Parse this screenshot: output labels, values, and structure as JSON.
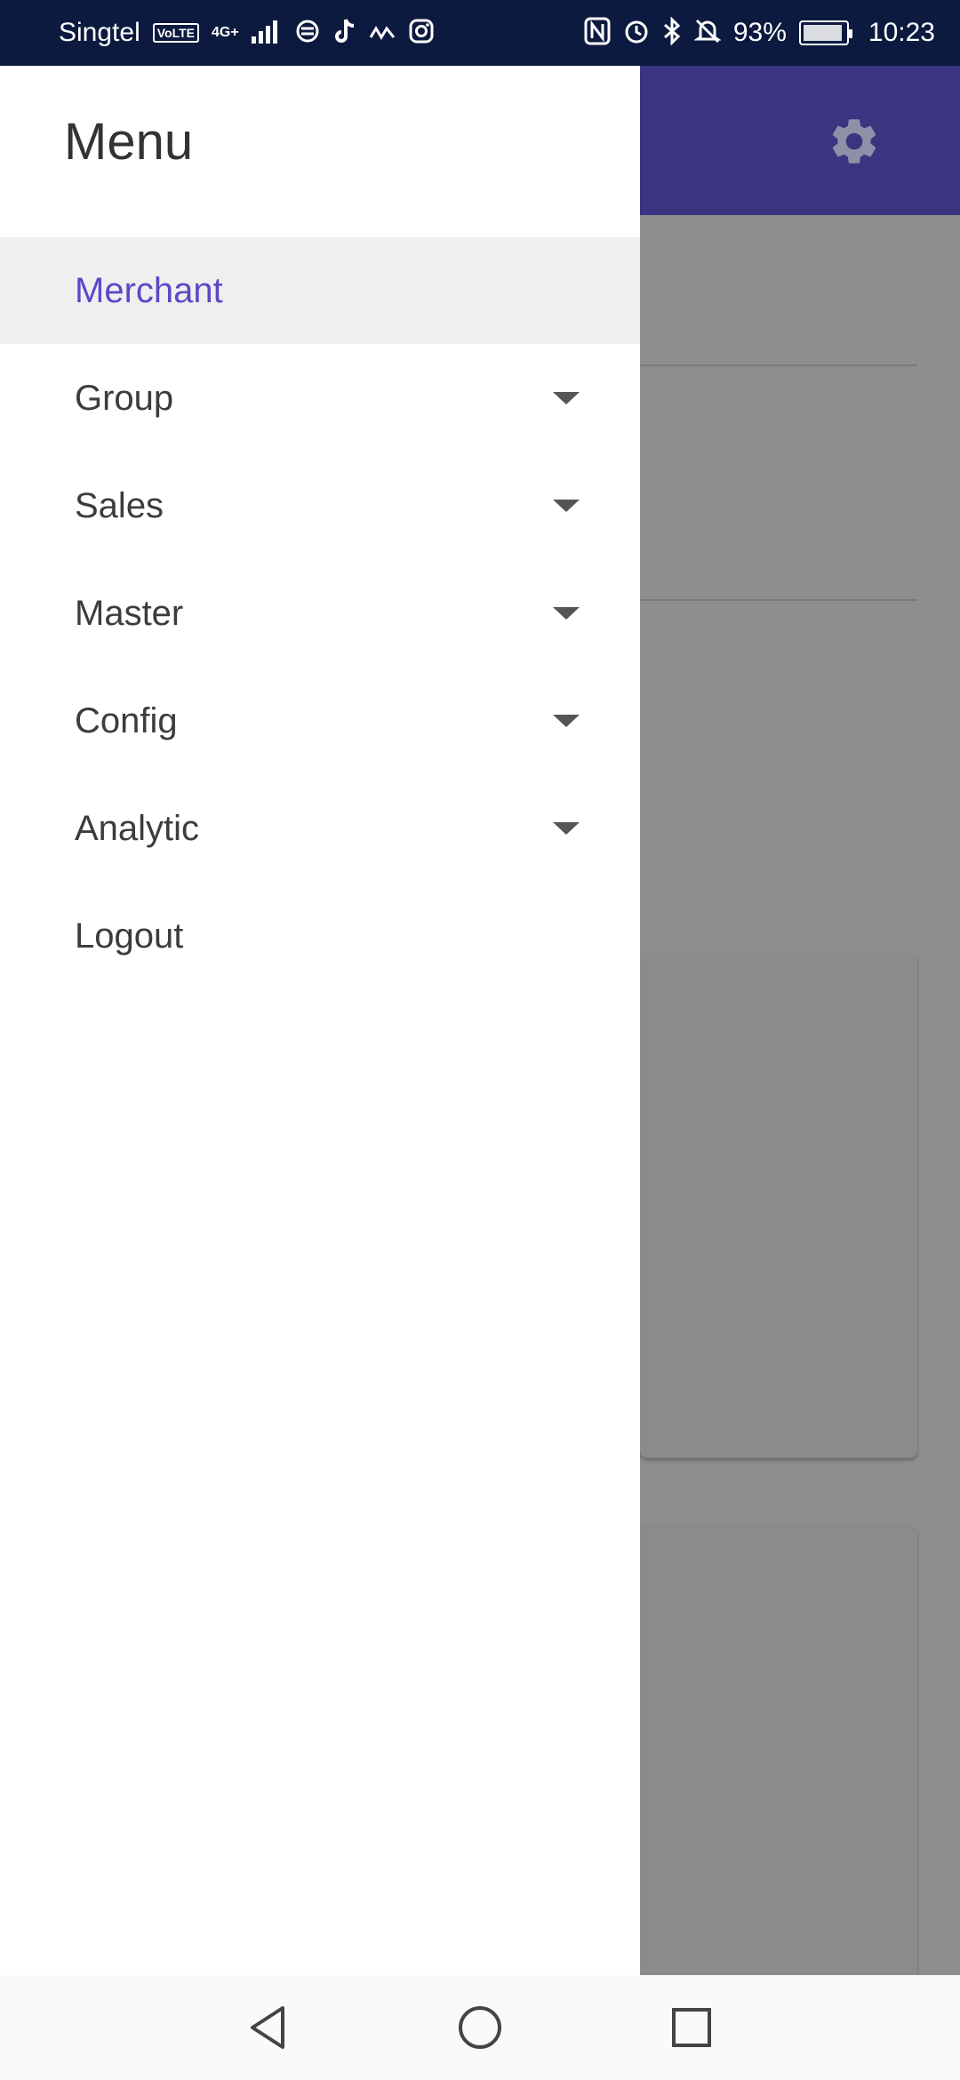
{
  "status_bar": {
    "carrier": "Singtel",
    "volte": "VoLTE",
    "network": "4G+",
    "battery_percent": "93%",
    "battery_level": 0.93,
    "time": "10:23",
    "icons": [
      "signal-icon",
      "app-notification-icon",
      "tiktok-icon",
      "wave-icon",
      "instagram-icon",
      "nfc-icon",
      "alarm-icon",
      "bluetooth-icon",
      "mute-icon",
      "battery-icon"
    ]
  },
  "app_bar": {
    "color": "#3b3480",
    "settings_icon": "gear-icon"
  },
  "drawer": {
    "title": "Menu",
    "items": [
      {
        "label": "Merchant",
        "active": true,
        "expandable": false
      },
      {
        "label": "Group",
        "active": false,
        "expandable": true
      },
      {
        "label": "Sales",
        "active": false,
        "expandable": true
      },
      {
        "label": "Master",
        "active": false,
        "expandable": true
      },
      {
        "label": "Config",
        "active": false,
        "expandable": true
      },
      {
        "label": "Analytic",
        "active": false,
        "expandable": true
      },
      {
        "label": "Logout",
        "active": false,
        "expandable": false
      }
    ],
    "accent_color": "#5b47c8"
  },
  "nav_bar": {
    "buttons": [
      "back-icon",
      "home-icon",
      "recents-icon"
    ]
  }
}
